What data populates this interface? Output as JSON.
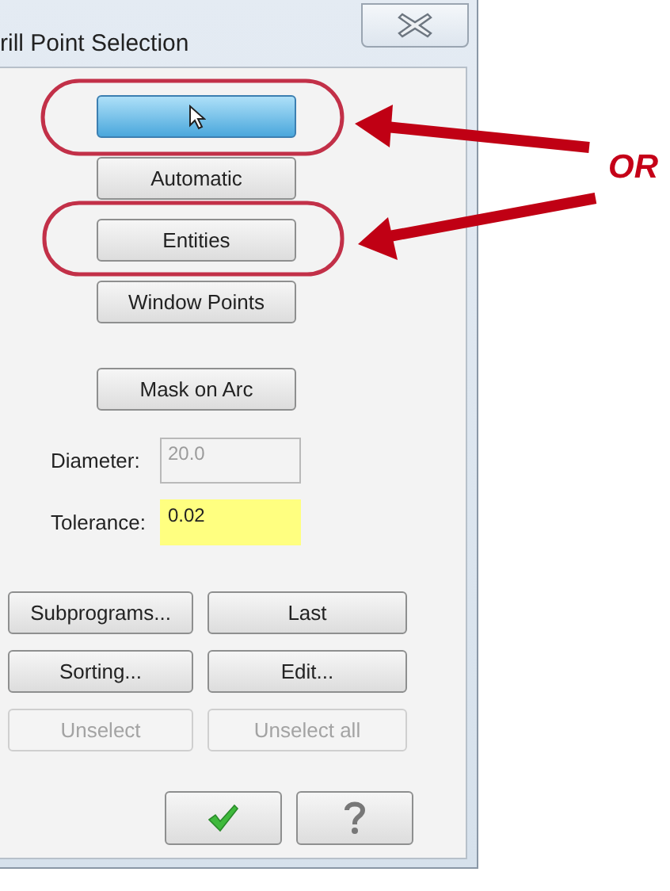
{
  "window": {
    "title": "rill Point Selection"
  },
  "selection_buttons": [
    {
      "selected": true
    },
    {
      "label": "Automatic",
      "selected": false
    },
    {
      "label": "Entities",
      "selected": false
    },
    {
      "label": "Window Points",
      "selected": false
    }
  ],
  "mask_button": "Mask on Arc",
  "fields": [
    {
      "label": "Diameter:",
      "value": "20.0",
      "disabled": true,
      "highlighted": false
    },
    {
      "label": "Tolerance:",
      "value": "0.02",
      "disabled": false,
      "highlighted": true
    }
  ],
  "action_buttons": [
    {
      "label": "Subprograms...",
      "disabled": false
    },
    {
      "label": "Last",
      "disabled": false
    },
    {
      "label": "Sorting...",
      "disabled": false
    },
    {
      "label": "Edit...",
      "disabled": false
    },
    {
      "label": "Unselect",
      "disabled": true
    },
    {
      "label": "Unselect all",
      "disabled": true
    }
  ],
  "annotation": {
    "text": "OR"
  }
}
